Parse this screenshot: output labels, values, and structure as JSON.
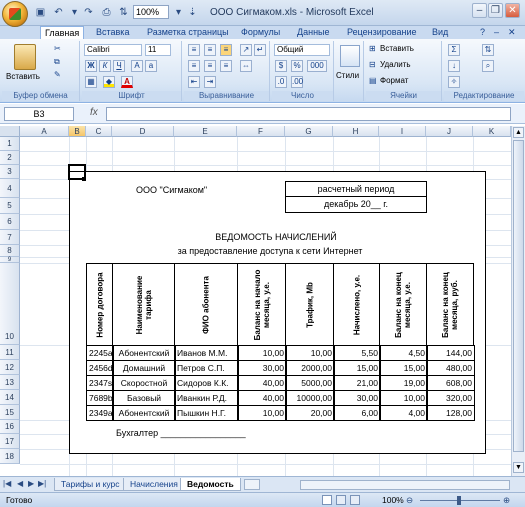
{
  "window": {
    "title": "ООО Сигмаком.xls - Microsoft Excel",
    "zoom": "100%"
  },
  "ribbon": {
    "tabs": [
      "Главная",
      "Вставка",
      "Разметка страницы",
      "Формулы",
      "Данные",
      "Рецензирование",
      "Вид"
    ],
    "clipboard": {
      "paste": "Вставить",
      "label": "Буфер обмена"
    },
    "font": {
      "name": "Calibri",
      "size": "11",
      "bold": "Ж",
      "italic": "К",
      "underline": "Ч",
      "fontcolor": "A",
      "label": "Шрифт"
    },
    "alignment": {
      "label": "Выравнивание"
    },
    "number": {
      "format": "Общий",
      "percent": "%",
      "thousands": "000",
      "label": "Число"
    },
    "styles": {
      "button": "Стили"
    },
    "cells": {
      "insert": "Вставить",
      "delete": "Удалить",
      "format": "Формат",
      "label": "Ячейки"
    },
    "editing": {
      "label": "Редактирование"
    }
  },
  "formula": {
    "namebox": "B3",
    "fx": "fx",
    "value": ""
  },
  "grid": {
    "columns": [
      "A",
      "B",
      "C",
      "D",
      "E",
      "F",
      "G",
      "H",
      "I",
      "J",
      "K"
    ],
    "rows": [
      "1",
      "2",
      "3",
      "4",
      "5",
      "6",
      "7",
      "8",
      "9",
      "10",
      "11",
      "12",
      "13",
      "14",
      "15",
      "16",
      "17",
      "18"
    ],
    "selected_col": "B"
  },
  "sheet": {
    "company": "ООО \"Сигмаком\"",
    "period_label": "расчетный период",
    "period_value": "декабрь 20__ г.",
    "title": "ВЕДОМОСТЬ НАЧИСЛЕНИЙ",
    "subtitle": "за предоставление доступа к сети Интернет",
    "headers": [
      "Номер договора",
      "Наименование тарифа",
      "ФИО абонента",
      "Баланс на начало месяца, у.е.",
      "Трафик, Mb",
      "Начислено, у.е.",
      "Баланс на конец месяца, у.е.",
      "Баланс на конец месяца, руб."
    ],
    "rows": [
      [
        "2245а",
        "Абонентский",
        "Иванов М.М.",
        "10,00",
        "10,00",
        "5,50",
        "4,50",
        "144,00"
      ],
      [
        "2456d",
        "Домашний",
        "Петров С.П.",
        "30,00",
        "2000,00",
        "15,00",
        "15,00",
        "480,00"
      ],
      [
        "2347s",
        "Скоростной",
        "Сидоров К.К.",
        "40,00",
        "5000,00",
        "21,00",
        "19,00",
        "608,00"
      ],
      [
        "7689b",
        "Базовый",
        "Иванкин Р.Д.",
        "40,00",
        "10000,00",
        "30,00",
        "10,00",
        "320,00"
      ],
      [
        "2349а",
        "Абонентский",
        "Пышкин Н.Г.",
        "10,00",
        "20,00",
        "6,00",
        "4,00",
        "128,00"
      ]
    ],
    "accountant": "Бухгалтер _________________"
  },
  "sheet_tabs": [
    "Тарифы и курс",
    "Начисления",
    "Ведомость"
  ],
  "status": {
    "text": "Готово",
    "zoom": "100%"
  }
}
